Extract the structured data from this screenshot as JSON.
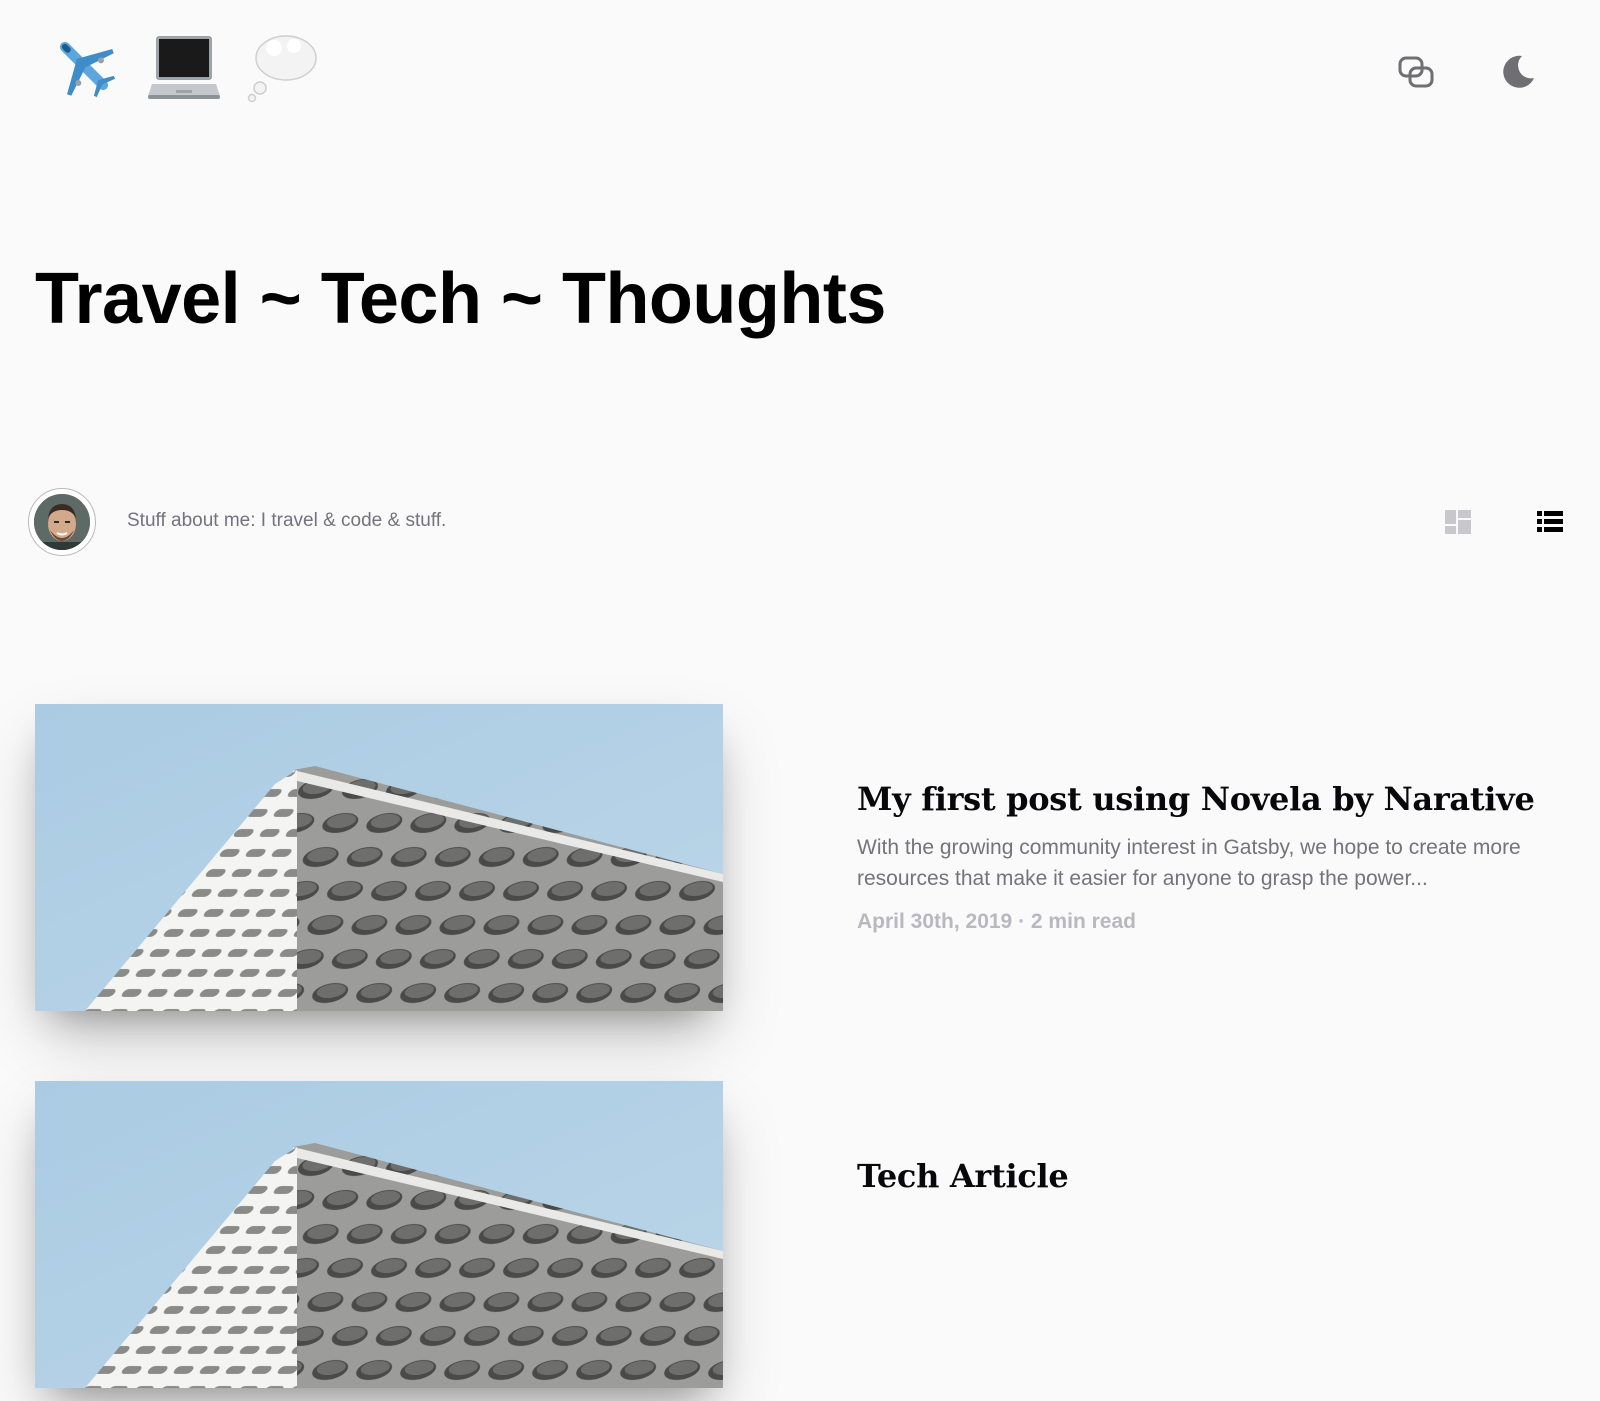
{
  "header": {
    "logo_emojis": [
      "airplane-emoji",
      "laptop-emoji",
      "thought-balloon-emoji"
    ],
    "actions": [
      {
        "icon": "copy-link-icon"
      },
      {
        "icon": "moon-icon"
      }
    ]
  },
  "hero": {
    "title": "Travel ~ Tech ~ Thoughts"
  },
  "author": {
    "bio": "Stuff about me: I travel & code & stuff."
  },
  "layout_toggles": [
    {
      "icon": "grid-layout-icon",
      "active": false
    },
    {
      "icon": "list-layout-icon",
      "active": true
    }
  ],
  "articles": [
    {
      "title": "My first post using Novela by Narative",
      "excerpt": "With the growing community interest in Gatsby, we hope to create more resources that make it easier for anyone to grasp the power...",
      "date": "April 30th, 2019",
      "separator": "·",
      "read_time": "2 min read"
    },
    {
      "title": "Tech Article"
    }
  ],
  "colors": {
    "background": "#fafafa",
    "text_primary": "#000000",
    "text_secondary": "#73737d",
    "text_muted": "#b8b8be",
    "sky": "#b7d3e6"
  }
}
